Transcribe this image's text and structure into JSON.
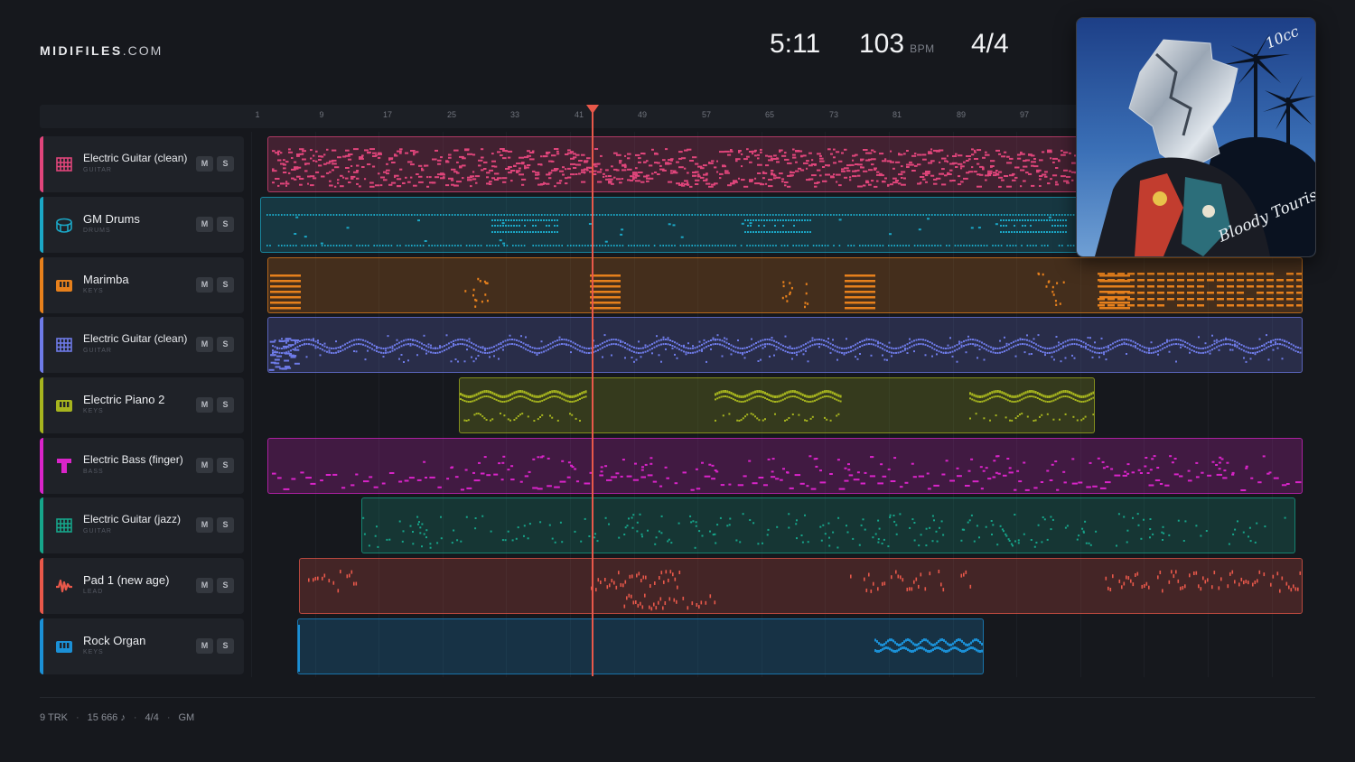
{
  "brand": {
    "name": "MIDIFILES",
    "domain": ".COM"
  },
  "transport": {
    "time": "5:11",
    "bpm": "103",
    "bpm_unit": "BPM",
    "signature": "4/4"
  },
  "ruler": {
    "ticks": [
      "1",
      "9",
      "17",
      "25",
      "33",
      "41",
      "49",
      "57",
      "65",
      "73",
      "81",
      "89",
      "97"
    ]
  },
  "playhead": {
    "bar": 43
  },
  "tracks": [
    {
      "name": "Electric Guitar (clean)",
      "category": "GUITAR",
      "color": "#e0457b",
      "icon": "guitar-fretboard-icon",
      "mute": "M",
      "solo": "S"
    },
    {
      "name": "GM Drums",
      "category": "DRUMS",
      "color": "#1ba7c6",
      "icon": "drum-icon",
      "mute": "M",
      "solo": "S"
    },
    {
      "name": "Marimba",
      "category": "KEYS",
      "color": "#e6801c",
      "icon": "keyboard-icon",
      "mute": "M",
      "solo": "S"
    },
    {
      "name": "Electric Guitar (clean)",
      "category": "GUITAR",
      "color": "#6e7be8",
      "icon": "guitar-fretboard-icon",
      "mute": "M",
      "solo": "S"
    },
    {
      "name": "Electric Piano 2",
      "category": "KEYS",
      "color": "#a6b41e",
      "icon": "keyboard-icon",
      "mute": "M",
      "solo": "S"
    },
    {
      "name": "Electric Bass (finger)",
      "category": "BASS",
      "color": "#d924c9",
      "icon": "bass-icon",
      "mute": "M",
      "solo": "S"
    },
    {
      "name": "Electric Guitar (jazz)",
      "category": "GUITAR",
      "color": "#16a58a",
      "icon": "guitar-fretboard-icon",
      "mute": "M",
      "solo": "S"
    },
    {
      "name": "Pad 1 (new age)",
      "category": "LEAD",
      "color": "#e8584a",
      "icon": "waveform-icon",
      "mute": "M",
      "solo": "S"
    },
    {
      "name": "Rock Organ",
      "category": "KEYS",
      "color": "#1b90d6",
      "icon": "keyboard-icon",
      "mute": "M",
      "solo": "S"
    }
  ],
  "album": {
    "artist_mark": "10cc",
    "title_mark": "Bloody Tourist"
  },
  "footer": {
    "tracks": "9 TRK",
    "notes": "15 666 ♪",
    "signature": "4/4",
    "standard": "GM"
  }
}
